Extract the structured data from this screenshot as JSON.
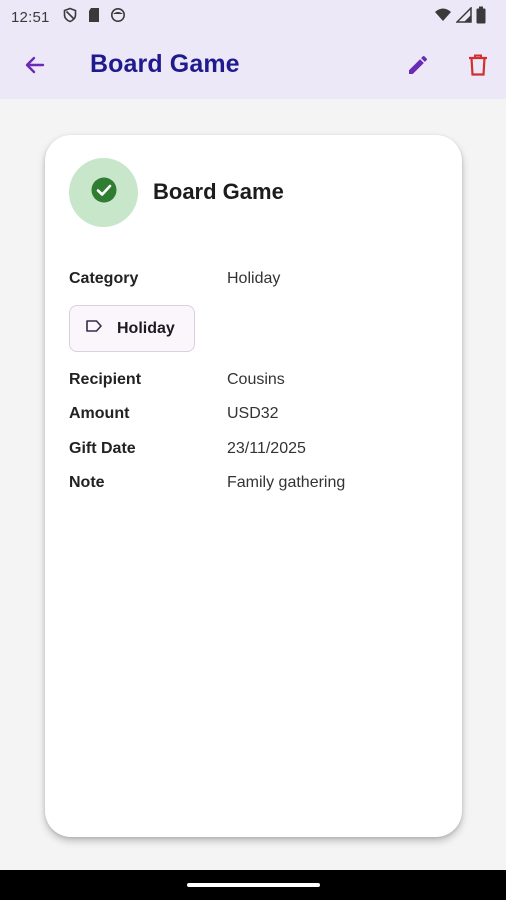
{
  "status_bar": {
    "time": "12:51",
    "left_icons": [
      "shield-icon",
      "sd-card-icon",
      "face-icon"
    ],
    "right_icons": [
      "wifi-icon",
      "signal-icon",
      "battery-icon"
    ]
  },
  "app_bar": {
    "title": "Board Game",
    "back_icon": "arrow-back-icon",
    "edit_icon": "edit-icon",
    "delete_icon": "delete-icon"
  },
  "detail_card": {
    "title": "Board Game",
    "status_icon": "check-circle-icon",
    "category": {
      "label": "Category",
      "value": "Holiday"
    },
    "chip": {
      "label": "Holiday",
      "icon": "label-icon"
    },
    "recipient": {
      "label": "Recipient",
      "value": "Cousins"
    },
    "amount": {
      "label": "Amount",
      "value": "USD32"
    },
    "gift_date": {
      "label": "Gift Date",
      "value": "23/11/2025"
    },
    "note": {
      "label": "Note",
      "value": "Family gathering"
    }
  },
  "colors": {
    "app_bar_bg": "#ece8f7",
    "title_color": "#1f1b8f",
    "accent_purple": "#6a2bb5",
    "delete_red": "#d32f2f",
    "success_green": "#2e7d32",
    "success_bg": "#c8e6c9"
  }
}
